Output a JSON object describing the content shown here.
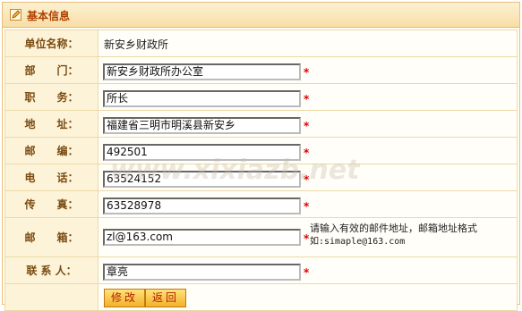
{
  "header": {
    "title": "基本信息",
    "icon": "edit-icon"
  },
  "form": {
    "unit_name": {
      "label": "单位名称：",
      "value": "新安乡财政所"
    },
    "department": {
      "label": "部　　门：",
      "value": "新安乡财政所办公室"
    },
    "position": {
      "label": "职　　务：",
      "value": "所长"
    },
    "address": {
      "label": "地　　址：",
      "value": "福建省三明市明溪县新安乡"
    },
    "postcode": {
      "label": "邮　　编：",
      "value": "492501"
    },
    "phone": {
      "label": "电　　话：",
      "value": "63524152"
    },
    "fax": {
      "label": "传　　真：",
      "value": "63528978"
    },
    "email": {
      "label": "邮　　箱：",
      "value": "zl@163.com",
      "hint_line1": "请输入有效的邮件地址，邮箱地址格式",
      "hint_line2": "如:simaple@163.com"
    },
    "contact": {
      "label": "联 系 人：",
      "value": "章亮"
    },
    "required_mark": "*"
  },
  "buttons": {
    "edit_label": "修改",
    "back_label": "返回"
  },
  "watermark": "www.xixiazb.net",
  "colors": {
    "accent": "#b04000",
    "required": "#e00000",
    "button": "#f3b12a"
  }
}
